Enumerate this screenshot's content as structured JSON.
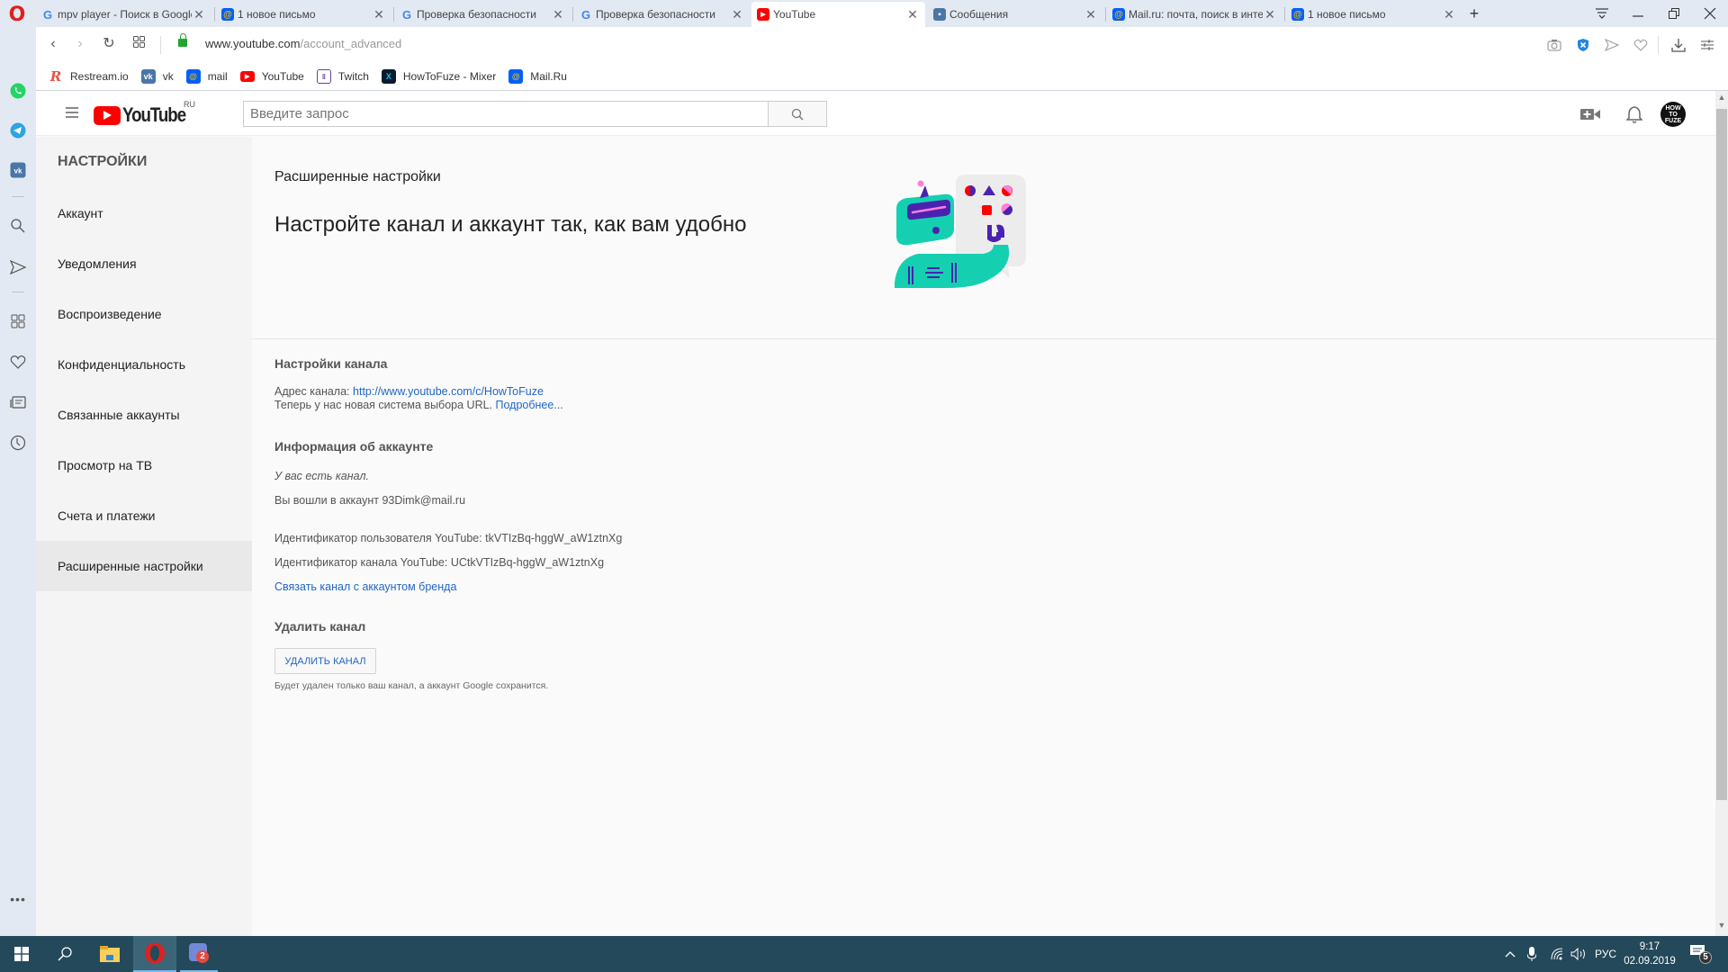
{
  "browser": {
    "tabs": [
      {
        "title": "mpv player - Поиск в Google",
        "favicon": "google-icon",
        "active": false
      },
      {
        "title": "1 новое письмо",
        "favicon": "mailru-icon",
        "active": false
      },
      {
        "title": "Проверка безопасности",
        "favicon": "google-icon",
        "active": false
      },
      {
        "title": "Проверка безопасности",
        "favicon": "google-icon",
        "active": false
      },
      {
        "title": "YouTube",
        "favicon": "youtube-icon",
        "active": true
      },
      {
        "title": "Сообщения",
        "favicon": "vk-messages-icon",
        "active": false
      },
      {
        "title": "Mail.ru: почта, поиск в интернете",
        "favicon": "mailru-icon",
        "active": false
      },
      {
        "title": "1 новое письмо",
        "favicon": "mailru-icon",
        "active": false
      }
    ],
    "new_tab_label": "+",
    "url_domain": "www.youtube.com",
    "url_path": "/account_advanced",
    "bookmarks": [
      {
        "label": "Restream.io",
        "icon": "restream-icon"
      },
      {
        "label": "vk",
        "icon": "vk-icon"
      },
      {
        "label": "mail",
        "icon": "mailru-icon"
      },
      {
        "label": "YouTube",
        "icon": "youtube-icon"
      },
      {
        "label": "Twitch",
        "icon": "twitch-icon"
      },
      {
        "label": "HowToFuze - Mixer",
        "icon": "mixer-icon"
      },
      {
        "label": "Mail.Ru",
        "icon": "mailru-icon"
      }
    ]
  },
  "youtube": {
    "logo_text": "YouTube",
    "logo_region": "RU",
    "search_placeholder": "Введите запрос",
    "avatar_text": "HOW TO FUZE",
    "nav": {
      "title": "НАСТРОЙКИ",
      "items": [
        {
          "label": "Аккаунт",
          "active": false
        },
        {
          "label": "Уведомления",
          "active": false
        },
        {
          "label": "Воспроизведение",
          "active": false
        },
        {
          "label": "Конфиденциальность",
          "active": false
        },
        {
          "label": "Связанные аккаунты",
          "active": false
        },
        {
          "label": "Просмотр на ТВ",
          "active": false
        },
        {
          "label": "Счета и платежи",
          "active": false
        },
        {
          "label": "Расширенные настройки",
          "active": true
        }
      ]
    },
    "content": {
      "subtitle": "Расширенные настройки",
      "title": "Настройте канал и аккаунт так, как вам удобно",
      "channel_settings_heading": "Настройки канала",
      "channel_url_label": "Адрес канала:",
      "channel_url": "http://www.youtube.com/c/HowToFuze",
      "url_system_text": "Теперь у нас новая система выбора URL.",
      "learn_more": "Подробнее...",
      "account_info_heading": "Информация об аккаунте",
      "has_channel": "У вас есть канал.",
      "signed_in_as": "Вы вошли в аккаунт 93Dimk@mail.ru",
      "user_id": "Идентификатор пользователя YouTube: tkVTIzBq-hggW_aW1ztnXg",
      "channel_id": "Идентификатор канала YouTube: UCtkVTIzBq-hggW_aW1ztnXg",
      "link_brand": "Связать канал с аккаунтом бренда",
      "delete_heading": "Удалить канал",
      "delete_button": "УДАЛИТЬ КАНАЛ",
      "delete_note": "Будет удален только ваш канал, а аккаунт Google сохранится."
    }
  },
  "taskbar": {
    "language": "РУС",
    "time": "9:17",
    "date": "02.09.2019",
    "notifications_count": "5",
    "discord_badge": "2"
  }
}
